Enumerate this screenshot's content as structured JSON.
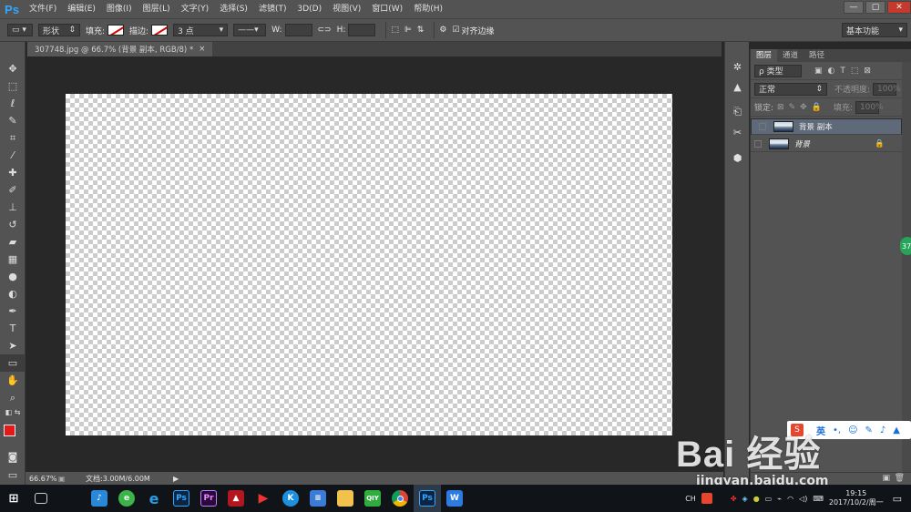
{
  "app": {
    "logo": "Ps",
    "menus": [
      "文件(F)",
      "编辑(E)",
      "图像(I)",
      "图层(L)",
      "文字(Y)",
      "选择(S)",
      "滤镜(T)",
      "3D(D)",
      "视图(V)",
      "窗口(W)",
      "帮助(H)"
    ],
    "win_controls": [
      "—",
      "▢",
      "✕"
    ]
  },
  "options": {
    "mode": "形状",
    "fill_label": "填充:",
    "stroke_label": "描边:",
    "stroke_size": "3 点",
    "w_label": "W:",
    "h_label": "H:",
    "align_label": "对齐边缘",
    "workspace": "基本功能"
  },
  "document": {
    "tab": "307748.jpg @ 66.7% (背景 副本, RGB/8) *",
    "close": "×"
  },
  "status": {
    "zoom": "66.67%",
    "doc": "文档:3.00M/6.00M"
  },
  "layers_panel": {
    "tabs": [
      "图层",
      "通道",
      "路径"
    ],
    "kind": "ρ 类型",
    "blend": "正常",
    "opacity_label": "不透明度:",
    "opacity": "100%",
    "lock_label": "锁定:",
    "fill_label": "填充:",
    "fill": "100%",
    "layers": [
      {
        "name": "背景 副本",
        "selected": true
      },
      {
        "name": "背景",
        "selected": false
      }
    ]
  },
  "badge": "37",
  "ime": {
    "lang": "英"
  },
  "watermark": {
    "logo": "Bai 经验",
    "url": "jingyan.baidu.com"
  },
  "tray": {
    "lang": "CH",
    "time": "19:15",
    "date": "2017/10/2/周一"
  },
  "colors": {
    "fg": "#e41a1a",
    "bg": "#ffffff",
    "accent": "#31a8ff"
  }
}
